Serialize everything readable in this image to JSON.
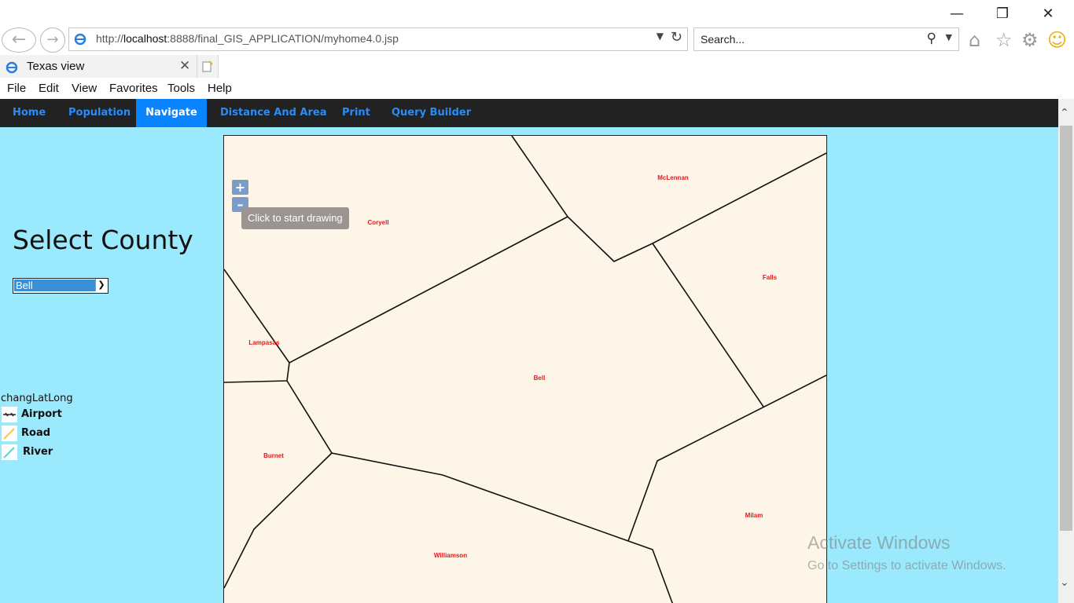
{
  "browser": {
    "url_prefix": "http://",
    "url_host": "localhost",
    "url_rest": ":8888/final_GIS_APPLICATION/myhome4.0.jsp",
    "search_placeholder": "Search...",
    "tab_title": "Texas view",
    "menu": [
      "File",
      "Edit",
      "View",
      "Favorites",
      "Tools",
      "Help"
    ]
  },
  "nav": {
    "items": [
      {
        "label": "Home",
        "active": false
      },
      {
        "label": "Population",
        "active": false
      },
      {
        "label": "Navigate",
        "active": true
      },
      {
        "label": "Distance And Area",
        "active": false
      },
      {
        "label": "Print",
        "active": false
      },
      {
        "label": "Query Builder",
        "active": false
      }
    ]
  },
  "sidebar": {
    "title": "Select County",
    "selected_county": "Bell",
    "legend_title": "changLatLong",
    "legend": [
      {
        "label": "Airport",
        "icon": "airport-icon"
      },
      {
        "label": "Road",
        "icon": "road-icon",
        "color": "#f2c94c"
      },
      {
        "label": "River",
        "icon": "river-icon",
        "color": "#5ad7c8"
      }
    ]
  },
  "map": {
    "zoom_in": "+",
    "zoom_out": "–",
    "tooltip": "Click to start drawing",
    "counties": [
      "Coryell",
      "McLennan",
      "Falls",
      "Lampasas",
      "Bell",
      "Burnet",
      "Milam",
      "Williamson"
    ],
    "label_color": "#e31a1c"
  },
  "watermark": {
    "line1": "Activate Windows",
    "line2": "Go to Settings to activate Windows."
  }
}
